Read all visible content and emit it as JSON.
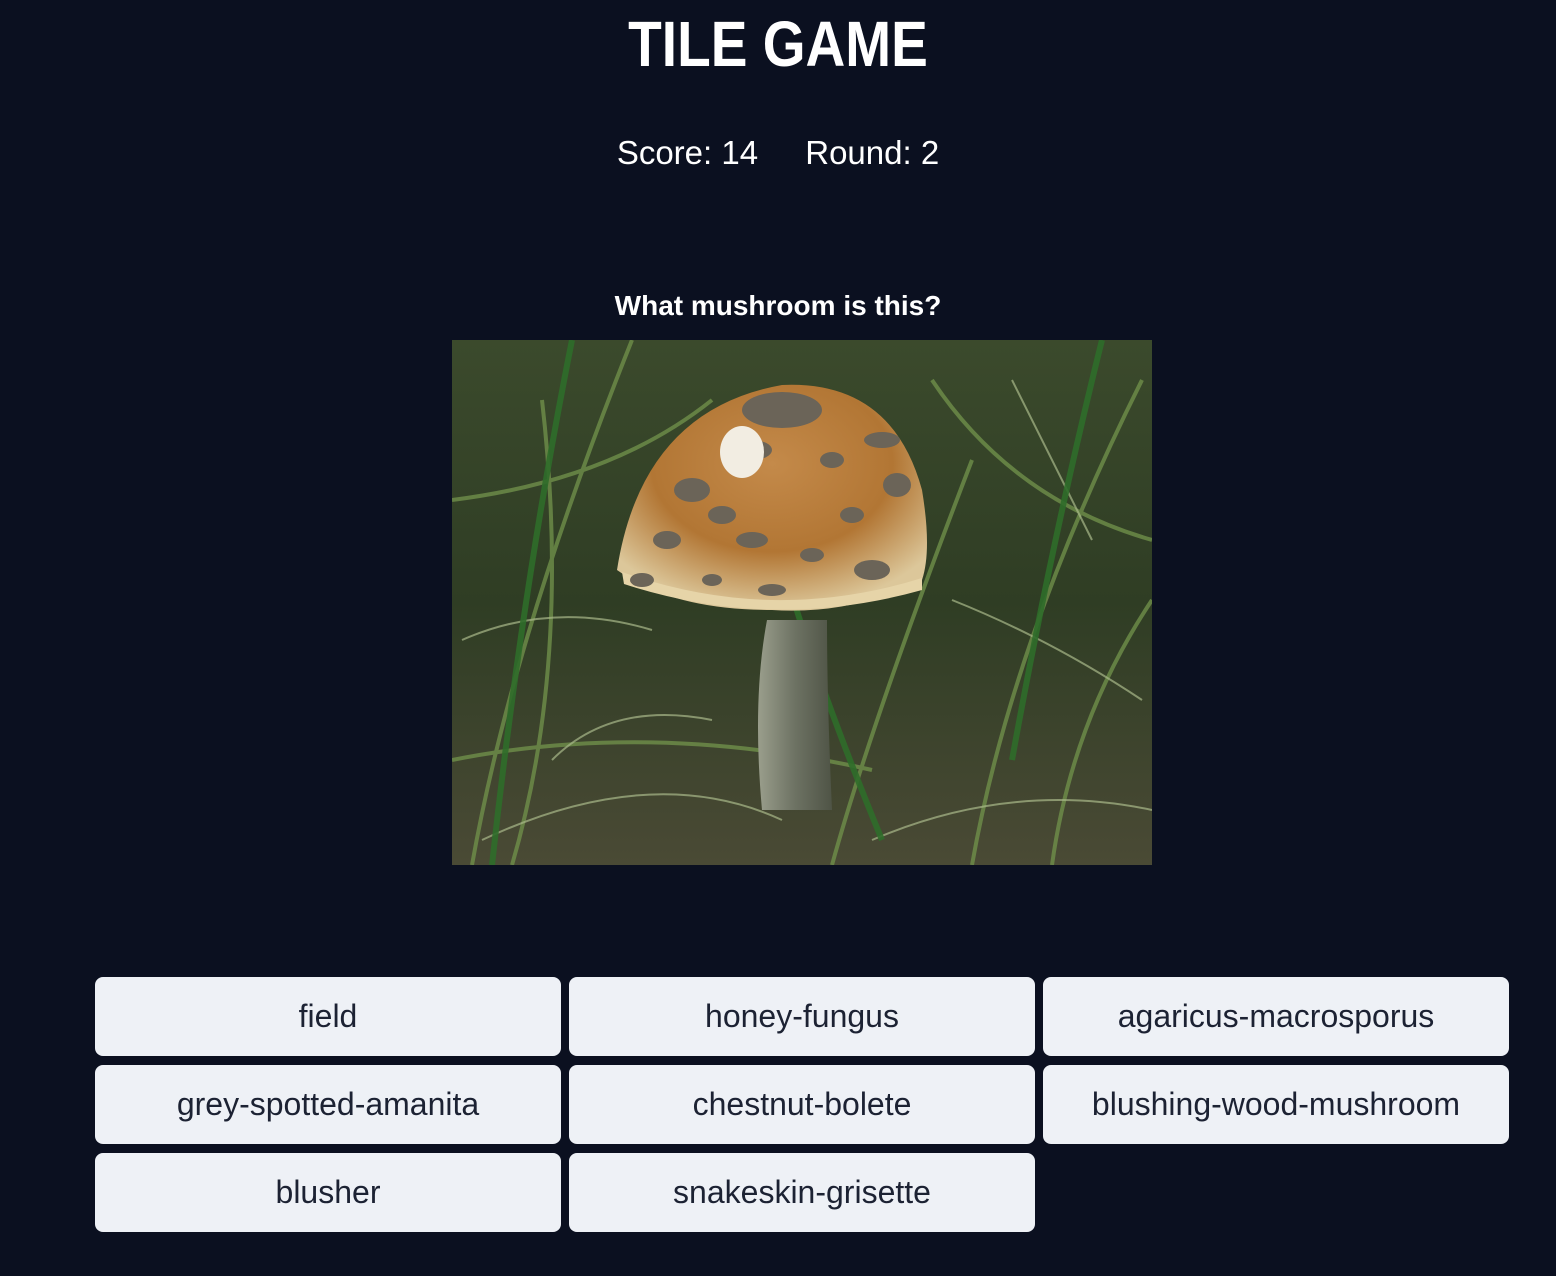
{
  "header": {
    "title": "TILE GAME"
  },
  "stats": {
    "score_label": "Score: 14",
    "round_label": "Round: 2"
  },
  "question": {
    "text": "What mushroom is this?"
  },
  "answers": [
    {
      "label": "field"
    },
    {
      "label": "honey-fungus"
    },
    {
      "label": "agaricus-macrosporus"
    },
    {
      "label": "grey-spotted-amanita"
    },
    {
      "label": "chestnut-bolete"
    },
    {
      "label": "blushing-wood-mushroom"
    },
    {
      "label": "blusher"
    },
    {
      "label": "snakeskin-grisette"
    }
  ],
  "colors": {
    "background": "#0b1020",
    "button_bg": "#eef1f6",
    "button_text": "#1c2233"
  }
}
